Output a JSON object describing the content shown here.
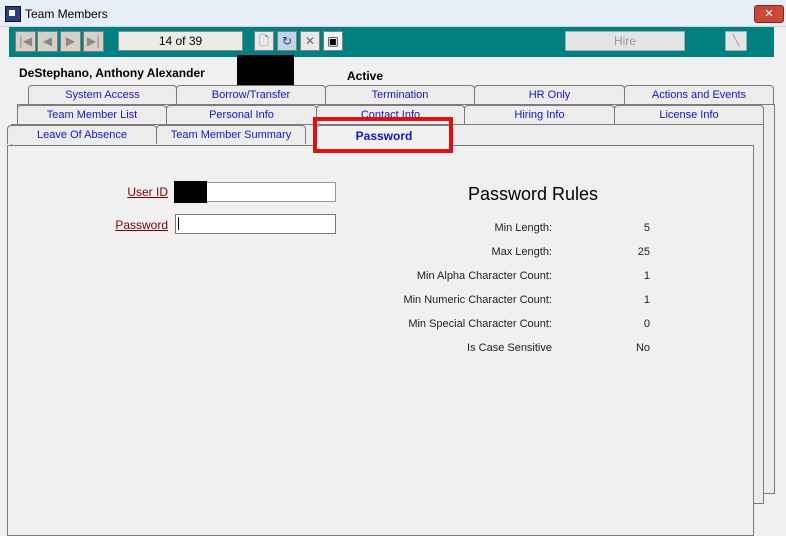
{
  "window": {
    "title": "Team Members",
    "close_glyph": "✕"
  },
  "toolbar": {
    "record_counter": "14 of 39",
    "hire_label": "Hire",
    "nav": {
      "first": "|◀",
      "prev": "◀",
      "next": "▶",
      "last": "▶|"
    },
    "icons": [
      "new-document-icon",
      "refresh-icon",
      "delete-icon",
      "save-icon",
      "edit-icon"
    ]
  },
  "member": {
    "name": "DeStephano, Anthony Alexander",
    "status": "Active"
  },
  "tabs": {
    "row1": [
      "System Access",
      "Borrow/Transfer",
      "Termination",
      "HR Only",
      "Actions and Events"
    ],
    "row2": [
      "Team Member List",
      "Personal Info",
      "Contact Info",
      "Hiring Info",
      "License Info"
    ],
    "row3": [
      "Leave Of Absence",
      "Team Member Summary",
      "Password"
    ]
  },
  "form": {
    "user_id_label": "User ID",
    "user_id_value": "",
    "password_label": "Password",
    "password_value": ""
  },
  "rules": {
    "title": "Password Rules",
    "items": [
      {
        "label": "Min Length:",
        "value": "5"
      },
      {
        "label": "Max Length:",
        "value": "25"
      },
      {
        "label": "Min Alpha Character Count:",
        "value": "1"
      },
      {
        "label": "Min Numeric Character Count:",
        "value": "1"
      },
      {
        "label": "Min Special Character Count:",
        "value": "0"
      },
      {
        "label": "Is Case Sensitive",
        "value": "No"
      }
    ]
  },
  "colors": {
    "toolbar": "#008080",
    "tab_text": "#1616c0",
    "label_text": "#7a0000",
    "highlight": "#e01010"
  }
}
